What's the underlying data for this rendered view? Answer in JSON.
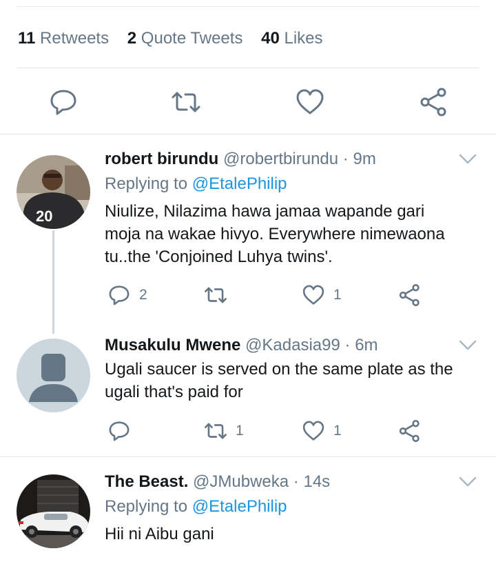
{
  "stats": {
    "retweets_count": "11",
    "retweets_label": "Retweets",
    "quotes_count": "2",
    "quotes_label": "Quote Tweets",
    "likes_count": "40",
    "likes_label": "Likes"
  },
  "icons": {
    "reply": "reply-icon",
    "retweet": "retweet-icon",
    "like": "heart-icon",
    "share": "share-icon",
    "more": "chevron-down-icon"
  },
  "colors": {
    "icon": "#657786",
    "link": "#1b95e0",
    "text": "#14171a",
    "secondary": "#657786",
    "divider": "#e1e8ed"
  },
  "replies": [
    {
      "name": "robert birundu",
      "handle": "@robertbirundu",
      "sep": "·",
      "time": "9m",
      "replying_label": "Replying to",
      "replying_to": "@EtalePhilip",
      "text_lines": [
        "Niulize, Nilazima hawa jamaa wapande gari",
        "moja na wakae hivyo. Everywhere nimewaona",
        "tu..the 'Conjoined Luhya twins'."
      ],
      "reply_count": "2",
      "retweet_count": "",
      "like_count": "1"
    },
    {
      "name": "Musakulu Mwene",
      "handle": "@Kadasia99",
      "sep": "·",
      "time": "6m",
      "text_lines": [
        "Ugali saucer is served on the same plate as the",
        "ugali that's paid for"
      ],
      "reply_count": "",
      "retweet_count": "1",
      "like_count": "1"
    },
    {
      "name": "The Beast.",
      "handle": "@JMubweka",
      "sep": "·",
      "time": "14s",
      "replying_label": "Replying to",
      "replying_to": "@EtalePhilip",
      "text_lines": [
        "Hii ni Aibu gani"
      ]
    }
  ]
}
